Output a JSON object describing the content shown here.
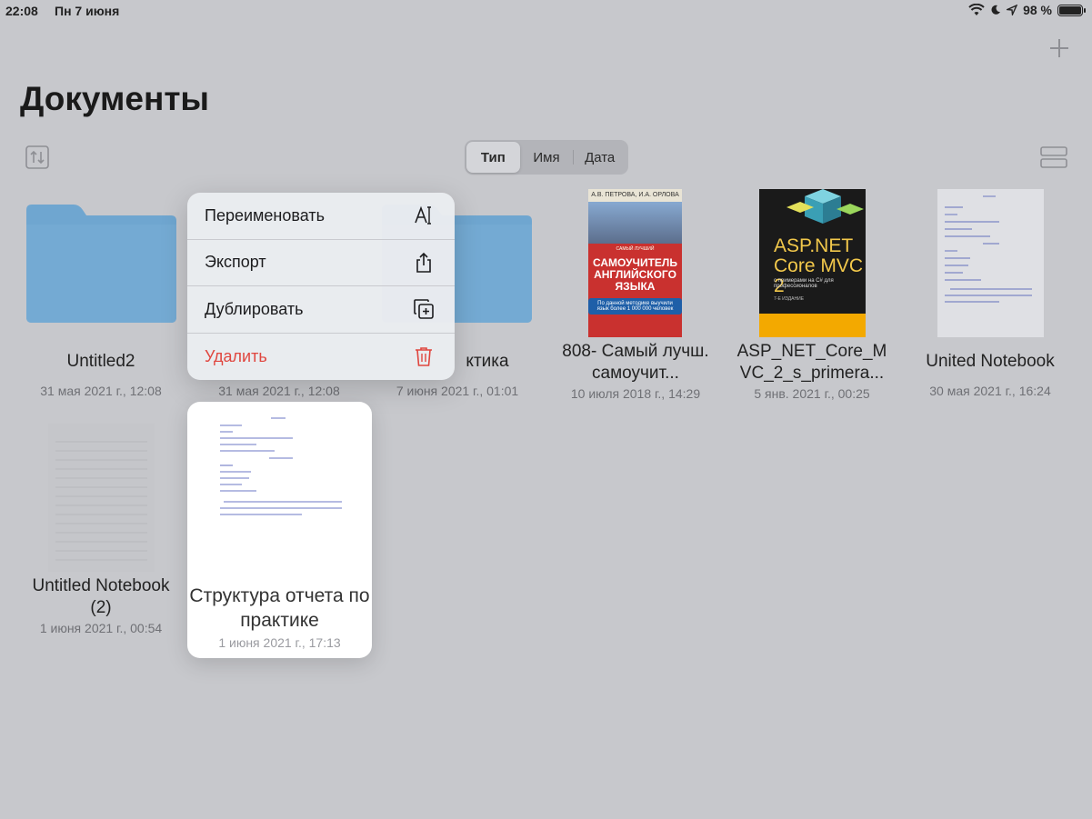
{
  "status_bar": {
    "time": "22:08",
    "date": "Пн 7 июня",
    "battery": "98 %",
    "battery_level": 0.98
  },
  "header": {
    "title": "Документы",
    "add_icon": "plus-icon"
  },
  "toolbar": {
    "sort_icon": "sort-arrows-icon",
    "segments": [
      {
        "label": "Тип",
        "active": true
      },
      {
        "label": "Имя",
        "active": false
      },
      {
        "label": "Дата",
        "active": false
      }
    ],
    "view_icon": "list-view-icon"
  },
  "documents": [
    {
      "name": "Untitled2",
      "date": "31 мая 2021 г., 12:08",
      "kind": "folder"
    },
    {
      "name": "",
      "date": "31 мая 2021 г., 12:08",
      "kind": "folder"
    },
    {
      "name": "ктика",
      "date": "7 июня 2021 г., 01:01",
      "kind": "folder"
    },
    {
      "name": "808- Самый лучш. самоучит...",
      "date": "10 июля 2018 г., 14:29",
      "kind": "book"
    },
    {
      "name": "ASP_NET_Core_MVC_2_s_primera...",
      "date": "5 янв. 2021 г., 00:25",
      "kind": "book"
    },
    {
      "name": "United Notebook",
      "date": "30 мая 2021 г., 16:24",
      "kind": "notebook"
    },
    {
      "name": "Untitled Notebook (2)",
      "date": "1 июня 2021 г., 00:54",
      "kind": "notebook"
    }
  ],
  "book1_cover": {
    "authors": "А.В. ПЕТРОВА, И.А. ОРЛОВА",
    "subtitle": "САМЫЙ ЛУЧШИЙ",
    "title": "САМОУЧИТЕЛЬ АНГЛИЙСКОГО ЯЗЫКА",
    "badge": "По данной методике выучили язык более 1 000 000 человек"
  },
  "book2_cover": {
    "title": "ASP.NET Core MVC 2",
    "subtitle": "с примерами на C# для профессионалов",
    "edition": "7-Е ИЗДАНИЕ"
  },
  "context_menu": {
    "items": [
      {
        "label": "Переименовать",
        "icon": "rename-text-icon",
        "destructive": false
      },
      {
        "label": "Экспорт",
        "icon": "share-icon",
        "destructive": false
      },
      {
        "label": "Дублировать",
        "icon": "duplicate-icon",
        "destructive": false
      },
      {
        "label": "Удалить",
        "icon": "trash-icon",
        "destructive": true
      }
    ]
  },
  "preview": {
    "name": "Структура отчета по практике",
    "date": "1 июня 2021 г., 17:13"
  },
  "colors": {
    "background": "#c7c8cc",
    "folder": "#6fa6d0",
    "destructive": "#e0463f"
  }
}
